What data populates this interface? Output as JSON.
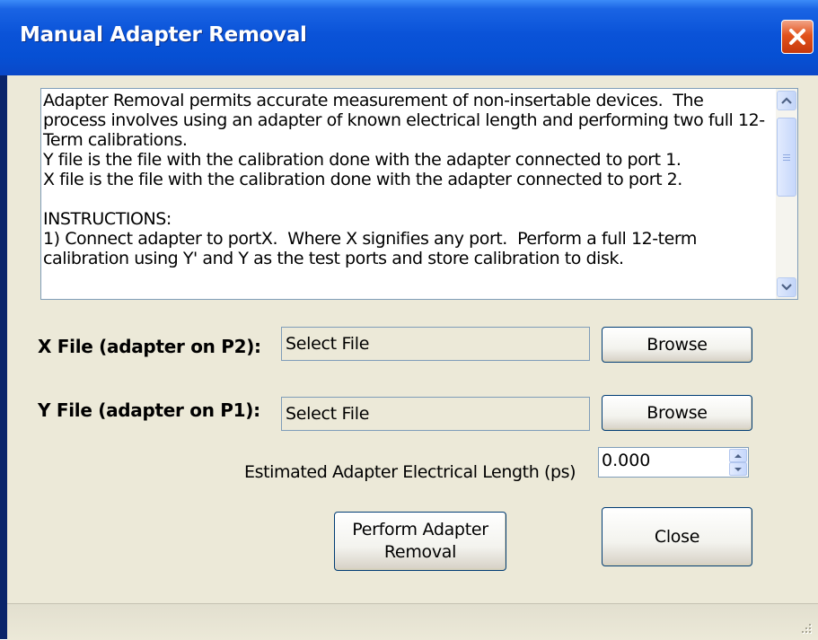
{
  "window": {
    "title": "Manual Adapter Removal",
    "close_icon": "close-icon"
  },
  "description": {
    "text": "Adapter Removal permits accurate measurement of non-insertable devices.  The process involves using an adapter of known electrical length and performing two full 12-Term calibrations.\nY file is the file with the calibration done with the adapter connected to port 1.\nX file is the file with the calibration done with the adapter connected to port 2.\n\nINSTRUCTIONS:\n1) Connect adapter to portX.  Where X signifies any port.  Perform a full 12-term calibration using Y' and Y as the test ports and store calibration to disk."
  },
  "x_file": {
    "label": "X File (adapter on P2):",
    "value": "Select File",
    "browse_label": "Browse"
  },
  "y_file": {
    "label": "Y File (adapter on P1):",
    "value": "Select File",
    "browse_label": "Browse"
  },
  "electrical_length": {
    "label": "Estimated Adapter Electrical Length (ps)",
    "value": "0.000"
  },
  "buttons": {
    "perform": "Perform Adapter Removal",
    "close": "Close"
  },
  "colors": {
    "titlebar": "#0650d4",
    "close_button": "#e2531c",
    "dialog_bg": "#ece9d8",
    "field_border": "#7f9db9",
    "button_border": "#003c74"
  }
}
